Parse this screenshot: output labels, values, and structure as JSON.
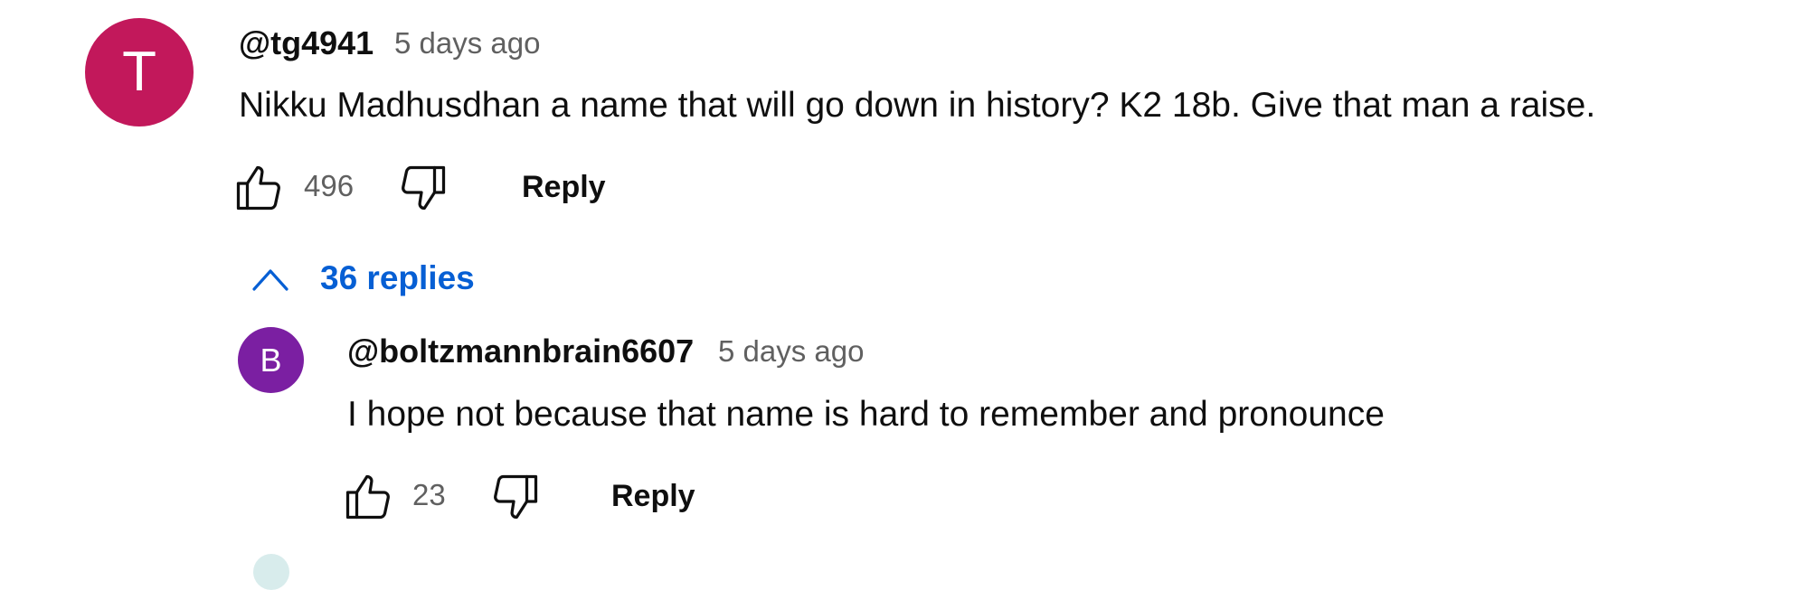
{
  "colors": {
    "avatar_main": "#c2185b",
    "avatar_reply": "#7b1fa2",
    "link_blue": "#065fd4",
    "secondary_text": "#606060",
    "peek_avatar": "#d8ecec"
  },
  "comment": {
    "avatar_letter": "T",
    "handle": "@tg4941",
    "time": "5 days ago",
    "text": "Nikku Madhusdhan a name that will go down in history? K2 18b. Give that man a raise.",
    "likes": "496",
    "reply_label": "Reply"
  },
  "replies_toggle": {
    "label": "36 replies",
    "icon": "chevron-up-icon"
  },
  "reply": {
    "avatar_letter": "B",
    "handle": "@boltzmannbrain6607",
    "time": "5 days ago",
    "text": "I hope not because that name is hard to remember and pronounce",
    "likes": "23",
    "reply_label": "Reply"
  }
}
